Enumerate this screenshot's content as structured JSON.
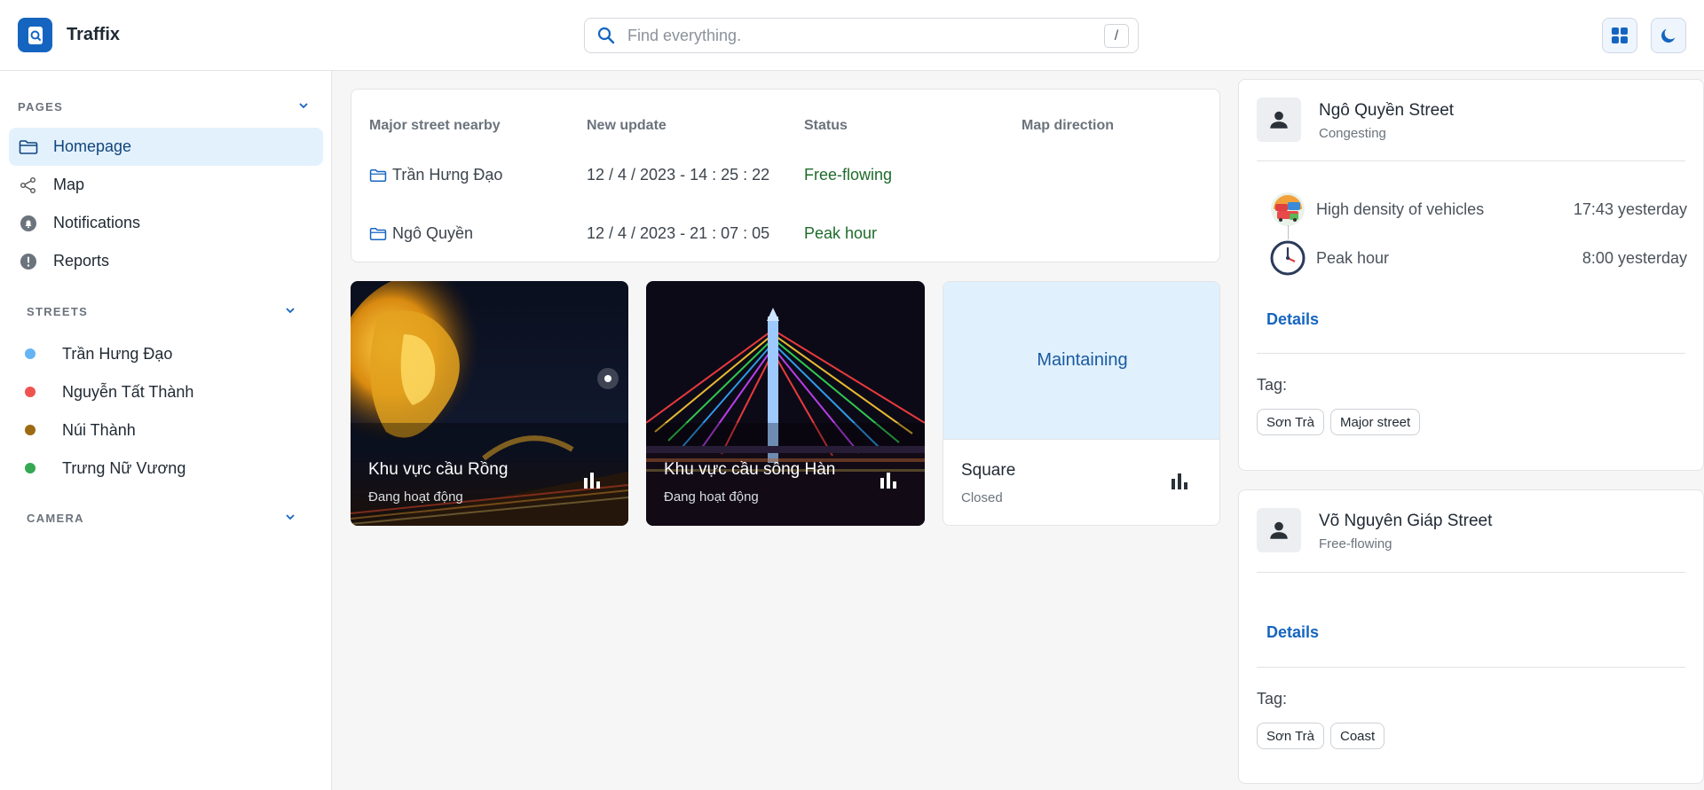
{
  "app": {
    "title": "Traffix"
  },
  "search": {
    "placeholder": "Find everything.",
    "shortcut": "/"
  },
  "sidebar": {
    "pages_title": "PAGES",
    "pages": [
      {
        "label": "Homepage",
        "icon": "folder-icon",
        "active": true
      },
      {
        "label": "Map",
        "icon": "share-icon"
      },
      {
        "label": "Notifications",
        "icon": "bell-icon"
      },
      {
        "label": "Reports",
        "icon": "alert-icon"
      }
    ],
    "streets_title": "STREETS",
    "streets": [
      {
        "label": "Trần Hưng Đạo",
        "color": "#64b5f6"
      },
      {
        "label": "Nguyễn Tất Thành",
        "color": "#ef5350"
      },
      {
        "label": "Núi Thành",
        "color": "#9c6a12"
      },
      {
        "label": "Trưng Nữ Vương",
        "color": "#34a853"
      }
    ],
    "camera_title": "CAMERA"
  },
  "table": {
    "headers": [
      "Major street nearby",
      "New update",
      "Status",
      "Map direction"
    ],
    "rows": [
      {
        "street": "Trần Hưng Đạo",
        "update": "12 / 4 / 2023 - 14 : 25 : 22",
        "status": "Free-flowing"
      },
      {
        "street": "Ngô Quyền",
        "update": "12 / 4 / 2023 - 21 : 07 : 05",
        "status": "Peak hour"
      }
    ]
  },
  "areas": [
    {
      "title": "Khu vực cầu Rồng",
      "subtitle": "Đang hoạt động"
    },
    {
      "title": "Khu vực cầu sông Hàn",
      "subtitle": "Đang hoạt động"
    },
    {
      "banner": "Maintaining",
      "title": "Square",
      "subtitle": "Closed"
    }
  ],
  "streets_detail": [
    {
      "title": "Ngô Quyền Street",
      "subtitle": "Congesting",
      "events": [
        {
          "label": "High density of vehicles",
          "time": "17:43 yesterday"
        },
        {
          "label": "Peak hour",
          "time": "8:00 yesterday"
        }
      ],
      "details_label": "Details",
      "tag_label": "Tag:",
      "tags": [
        "Sơn Trà",
        "Major street"
      ]
    },
    {
      "title": "Võ Nguyên Giáp Street",
      "subtitle": "Free-flowing",
      "details_label": "Details",
      "tag_label": "Tag:",
      "tags": [
        "Sơn Trà",
        "Coast"
      ]
    }
  ],
  "colors": {
    "accent": "#1565c0",
    "active_bg": "#e3f1fd",
    "status_green": "#1e6b2a"
  }
}
